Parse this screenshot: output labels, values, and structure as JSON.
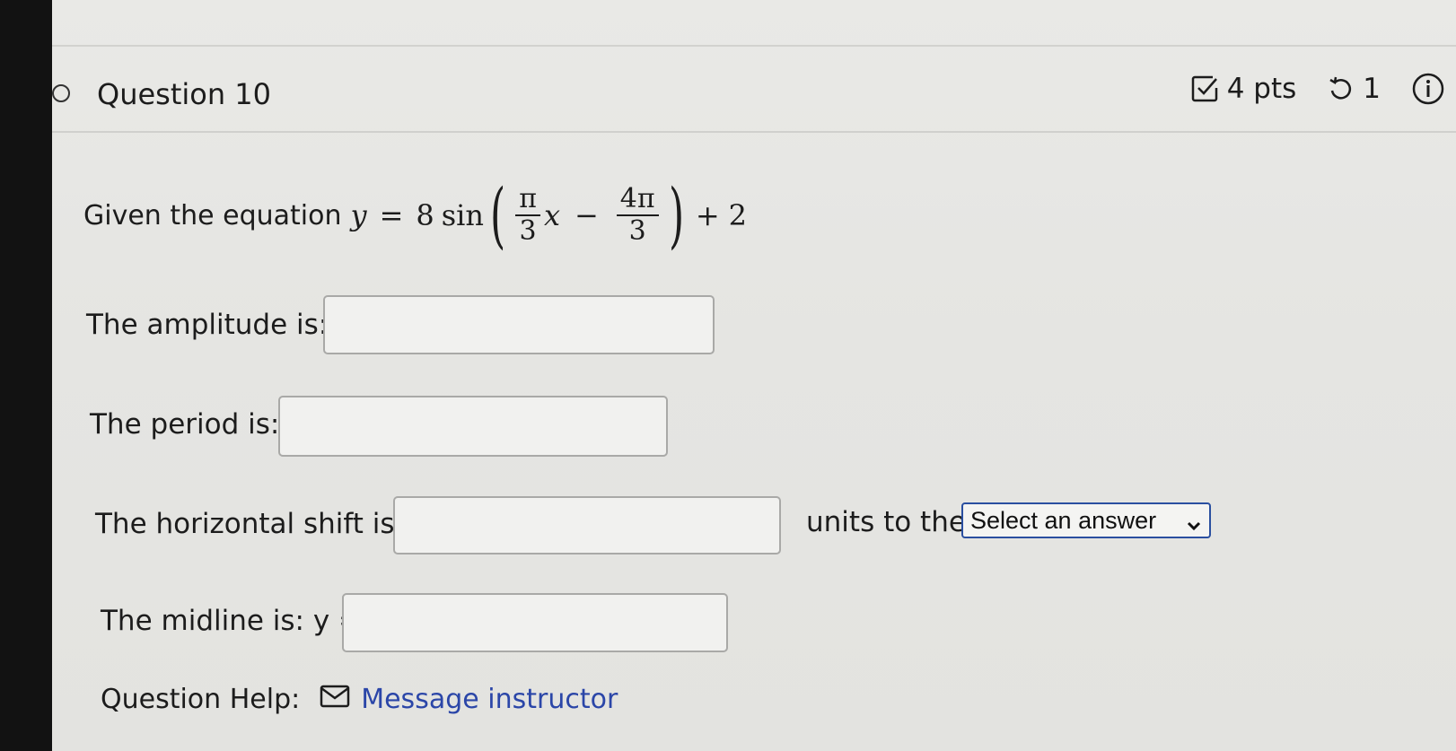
{
  "question": {
    "title": "Question 10",
    "points": "4 pts",
    "attempts": "1"
  },
  "equation": {
    "prefix": "Given the equation",
    "y": "y",
    "eq": "=",
    "coef": "8",
    "func": "sin",
    "frac1_num": "π",
    "frac1_den": "3",
    "var": "x",
    "minus": "−",
    "frac2_num": "4π",
    "frac2_den": "3",
    "plus": "+",
    "const": "2"
  },
  "fields": {
    "amplitude_label": "The amplitude is:",
    "period_label": "The period is:",
    "shift_label": "The horizontal shift is:",
    "units_label": "units to the",
    "midline_label": "The midline is: y =",
    "amplitude_value": "",
    "period_value": "",
    "shift_value": "",
    "midline_value": ""
  },
  "direction_select": {
    "selected": "Select an answer"
  },
  "help": {
    "label": "Question Help:",
    "link": "Message instructor"
  },
  "icons": {
    "status": "circle-outline-icon",
    "points": "checkbox-icon",
    "retry": "retry-icon",
    "info": "info-icon",
    "mail": "envelope-icon"
  },
  "colors": {
    "link": "#2b46a8",
    "select_border": "#2a4fa0"
  }
}
